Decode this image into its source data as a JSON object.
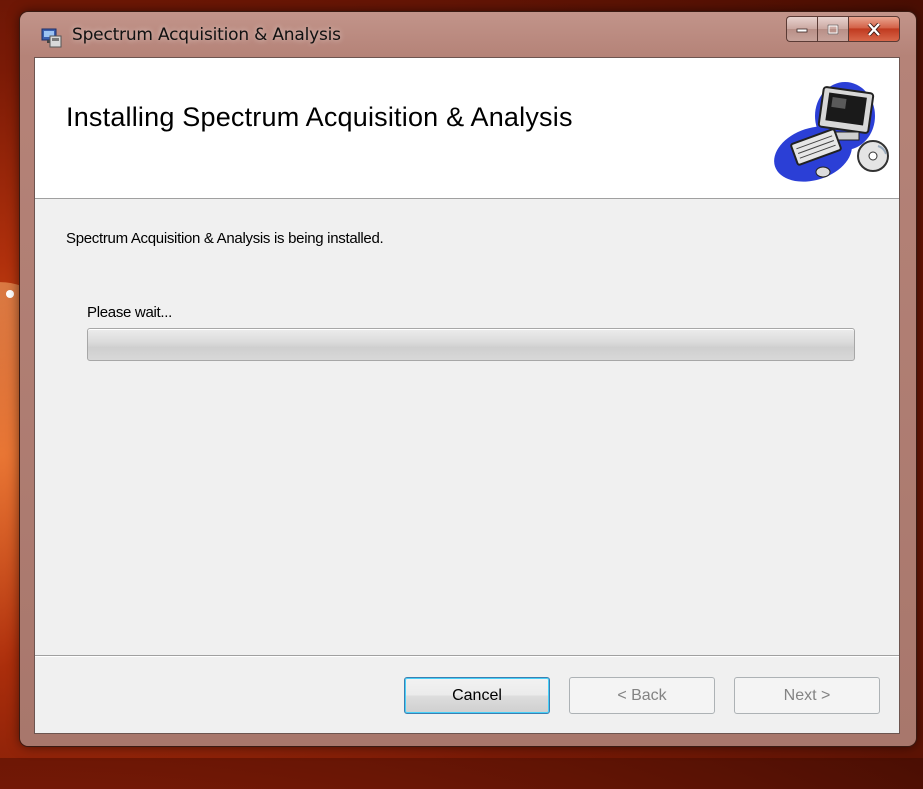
{
  "window": {
    "title": "Spectrum Acquisition & Analysis"
  },
  "caption_buttons": {
    "minimize_icon": "minimize-icon",
    "maximize_icon": "maximize-icon",
    "close_icon": "close-icon"
  },
  "header": {
    "title": "Installing Spectrum Acquisition & Analysis",
    "illustration": "computer-with-cd-icon"
  },
  "body": {
    "status_text": "Spectrum Acquisition & Analysis  is being installed.",
    "wait_text": "Please wait...",
    "progress": 0
  },
  "buttons": {
    "cancel": "Cancel",
    "back": "< Back",
    "next": "Next >"
  },
  "colors": {
    "client_bg": "#f0f0f0",
    "header_bg": "#ffffff",
    "close_button": "#c03a20"
  }
}
